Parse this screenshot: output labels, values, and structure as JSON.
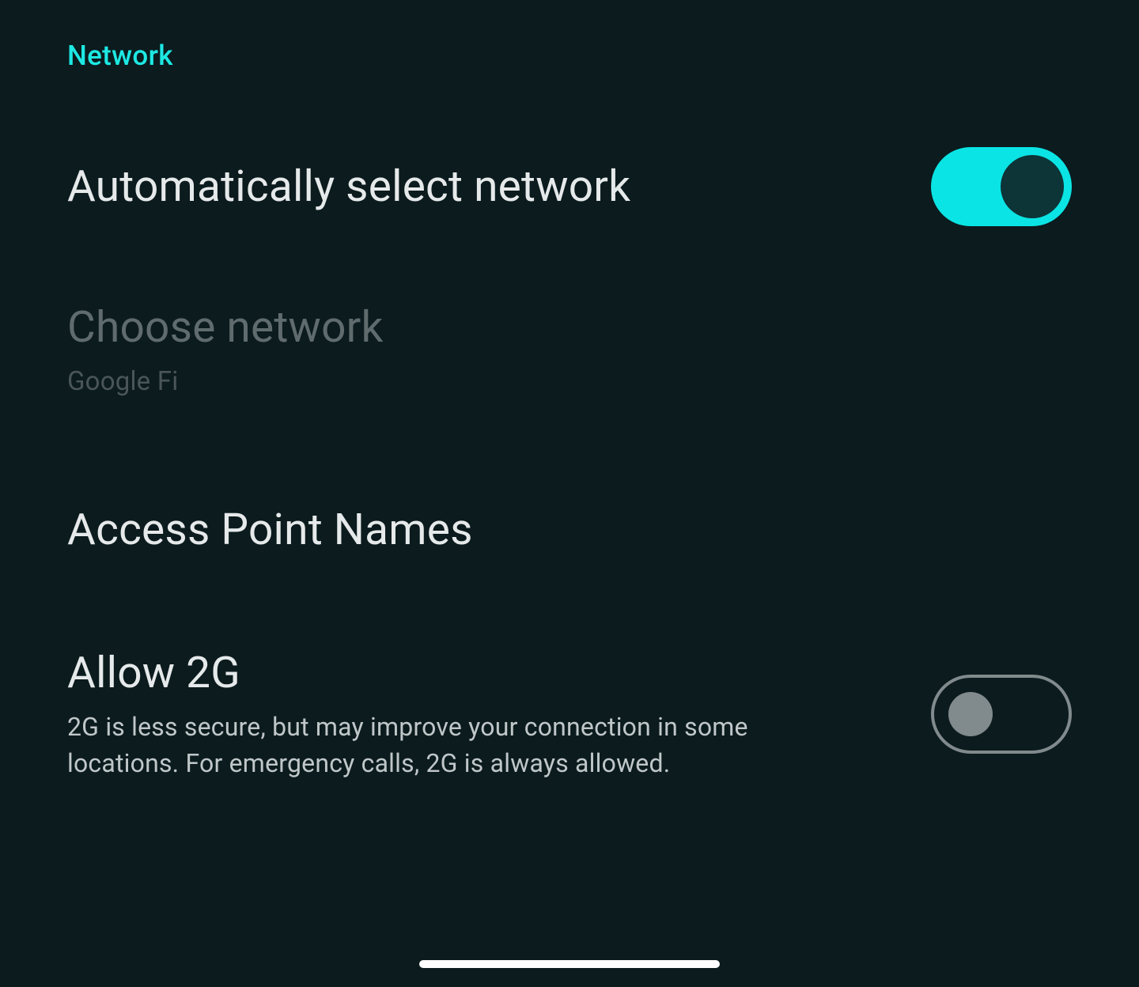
{
  "section_header": "Network",
  "settings": {
    "auto_select": {
      "title": "Automatically select network",
      "toggle_on": true
    },
    "choose_network": {
      "title": "Choose network",
      "subtitle": "Google Fi",
      "enabled": false
    },
    "apn": {
      "title": "Access Point Names"
    },
    "allow_2g": {
      "title": "Allow 2G",
      "subtitle": "2G is less secure, but may improve your connection in some locations. For emergency calls, 2G is always allowed.",
      "toggle_on": false
    }
  },
  "colors": {
    "accent": "#1de8e3",
    "background": "#0b1b1e",
    "text_primary": "#e6e9ea",
    "text_secondary": "#c0c7c9",
    "text_disabled": "#5f6b6d"
  }
}
